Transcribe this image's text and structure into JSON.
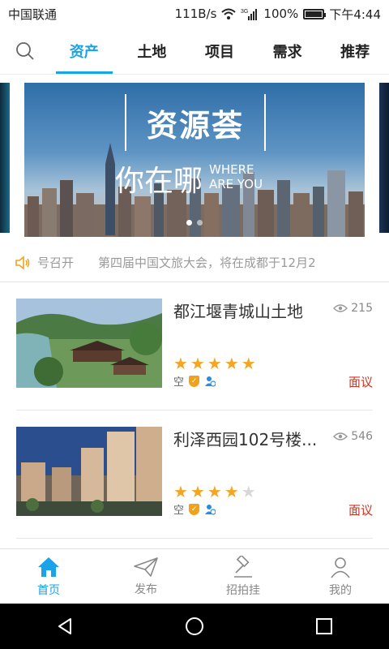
{
  "status_bar": {
    "carrier": "中国联通",
    "speed": "111B/s",
    "network": "3G",
    "battery": "100%",
    "time": "下午4:44"
  },
  "top_tabs": [
    {
      "label": "资产",
      "active": true
    },
    {
      "label": "土地",
      "active": false
    },
    {
      "label": "项目",
      "active": false
    },
    {
      "label": "需求",
      "active": false
    },
    {
      "label": "推荐",
      "active": false
    }
  ],
  "banner": {
    "title": "资源荟",
    "subtitle": "你在哪",
    "subtitle_en": "WHERE ARE YOU",
    "slide_count": 2,
    "active_slide": 1
  },
  "notice": {
    "text": "号召开　　第四届中国文旅大会，将在成都于12月2"
  },
  "listings": [
    {
      "title": "都江堰青城山土地",
      "views": "215",
      "rating": 5,
      "status": "空",
      "price": "面议"
    },
    {
      "title": "利泽西园102号楼...",
      "views": "546",
      "rating": 4,
      "status": "空",
      "price": "面议"
    }
  ],
  "bottom_nav": [
    {
      "label": "首页",
      "icon": "home-icon",
      "active": true
    },
    {
      "label": "发布",
      "icon": "paper-plane-icon",
      "active": false
    },
    {
      "label": "招拍挂",
      "icon": "gavel-icon",
      "active": false
    },
    {
      "label": "我的",
      "icon": "user-icon",
      "active": false
    }
  ],
  "colors": {
    "accent": "#1aa3e8",
    "star": "#f4a623",
    "price": "#d0321f"
  }
}
